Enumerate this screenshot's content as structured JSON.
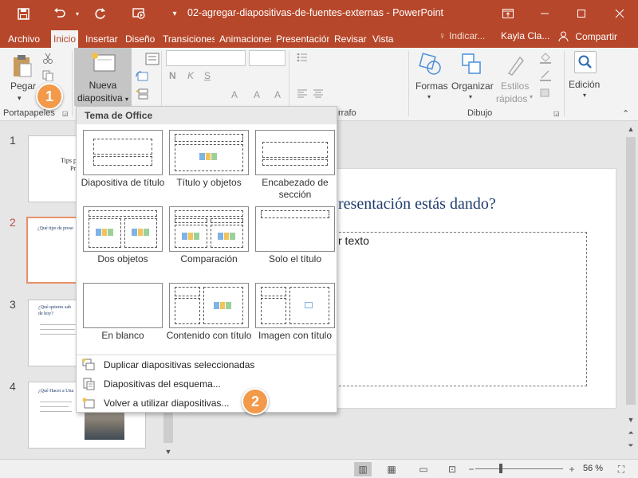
{
  "window": {
    "title": "02-agregar-diapositivas-de-fuentes-externas  -  PowerPoint",
    "icons": [
      "save-icon",
      "undo-icon",
      "redo-icon",
      "present-icon",
      "customize-icon",
      "ribbon-display-icon",
      "minimize-icon",
      "maximize-icon",
      "close-icon"
    ]
  },
  "tabs": [
    {
      "label": "Archivo"
    },
    {
      "label": "Inicio"
    },
    {
      "label": "Insertar"
    },
    {
      "label": "Diseño"
    },
    {
      "label": "Transiciones"
    },
    {
      "label": "Animaciones"
    },
    {
      "label": "Presentación"
    },
    {
      "label": "Revisar"
    },
    {
      "label": "Vista"
    }
  ],
  "tell_me": "Indicar...",
  "user_name": "Kayla Cla...",
  "share_label": "Compartir",
  "ribbon": {
    "paste_label": "Pegar",
    "new_slide_line1": "Nueva",
    "new_slide_line2": "diapositiva",
    "groups": {
      "clipboard": "Portapapeles",
      "paragraph": "rrafo",
      "drawing": "Dibujo"
    },
    "shapes_label": "Formas",
    "arrange_label": "Organizar",
    "styles_line1": "Estilos",
    "styles_line2": "rápidos",
    "editing_label": "Edición"
  },
  "thumbnails": [
    {
      "num": "1",
      "line1": "Tips p",
      "line2": "Pre"
    },
    {
      "num": "2",
      "line1": "¿Qué tipo de prese"
    },
    {
      "num": "3",
      "line1": "¿Qué quieres sab",
      "line2": "de hoy?"
    },
    {
      "num": "4",
      "line1": "¿Qué Hacer a Una"
    }
  ],
  "slide": {
    "title": "resentación estás dando?",
    "content": "r texto"
  },
  "dropdown": {
    "header": "Tema de Office",
    "layouts": [
      {
        "label": "Diapositiva de título"
      },
      {
        "label": "Título y objetos"
      },
      {
        "label": "Encabezado de sección"
      },
      {
        "label": "Dos objetos"
      },
      {
        "label": "Comparación"
      },
      {
        "label": "Solo el título"
      },
      {
        "label": "En blanco"
      },
      {
        "label": "Contenido con título"
      },
      {
        "label": "Imagen con título"
      }
    ],
    "items": [
      {
        "label": "Duplicar diapositivas seleccionadas"
      },
      {
        "label": "Diapositivas del esquema..."
      },
      {
        "label": "Volver a utilizar diapositivas..."
      }
    ]
  },
  "status": {
    "zoom": "56 %"
  },
  "callouts": [
    "1",
    "2"
  ],
  "colors": {
    "accent": "#b7472a",
    "callout": "#f29a4a",
    "selected_thumb": "#e8906b",
    "slide_title": "#1f3d6e"
  }
}
